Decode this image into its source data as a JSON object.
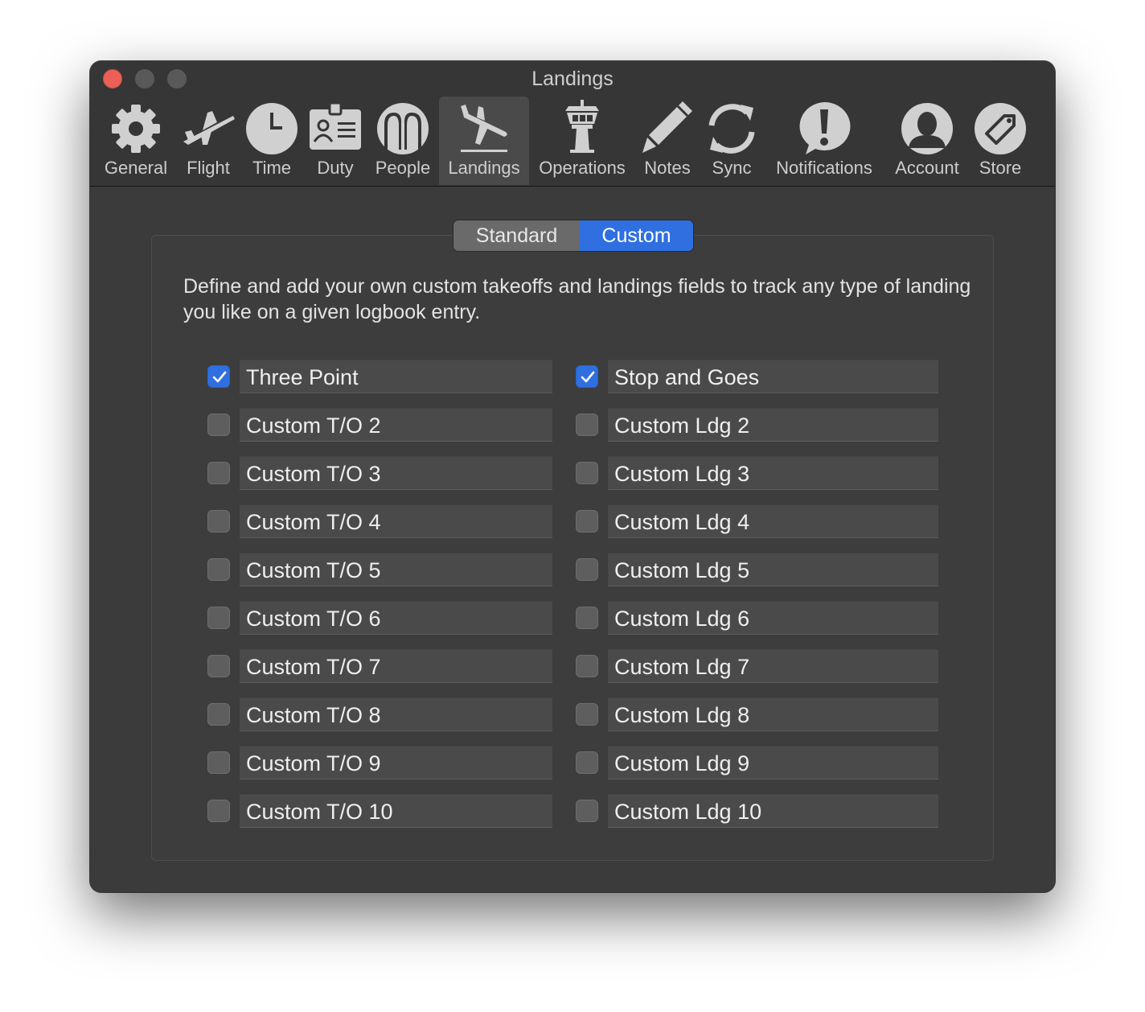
{
  "window": {
    "title": "Landings"
  },
  "toolbar": {
    "items": [
      {
        "label": "General",
        "icon": "gear-icon"
      },
      {
        "label": "Flight",
        "icon": "airplane-icon"
      },
      {
        "label": "Time",
        "icon": "clock-icon"
      },
      {
        "label": "Duty",
        "icon": "id-badge-icon"
      },
      {
        "label": "People",
        "icon": "people-icon"
      },
      {
        "label": "Landings",
        "icon": "landing-airplane-icon",
        "selected": true
      },
      {
        "label": "Operations",
        "icon": "control-tower-icon"
      },
      {
        "label": "Notes",
        "icon": "pencil-icon"
      },
      {
        "label": "Sync",
        "icon": "sync-icon"
      },
      {
        "label": "Notifications",
        "icon": "exclamation-bubble-icon"
      },
      {
        "label": "Account",
        "icon": "person-silhouette-icon"
      },
      {
        "label": "Store",
        "icon": "tag-icon"
      }
    ]
  },
  "segmented": {
    "standard_label": "Standard",
    "custom_label": "Custom",
    "selected": "Custom"
  },
  "description": "Define and add your own custom takeoffs and landings fields to track any type of landing you like on a given logbook entry.",
  "takeoffs": [
    {
      "label": "Three Point",
      "checked": true
    },
    {
      "label": "Custom T/O 2",
      "checked": false
    },
    {
      "label": "Custom T/O 3",
      "checked": false
    },
    {
      "label": "Custom T/O 4",
      "checked": false
    },
    {
      "label": "Custom T/O 5",
      "checked": false
    },
    {
      "label": "Custom T/O 6",
      "checked": false
    },
    {
      "label": "Custom T/O 7",
      "checked": false
    },
    {
      "label": "Custom T/O 8",
      "checked": false
    },
    {
      "label": "Custom T/O 9",
      "checked": false
    },
    {
      "label": "Custom T/O 10",
      "checked": false
    }
  ],
  "landings": [
    {
      "label": "Stop and Goes",
      "checked": true
    },
    {
      "label": "Custom Ldg 2",
      "checked": false
    },
    {
      "label": "Custom Ldg 3",
      "checked": false
    },
    {
      "label": "Custom Ldg 4",
      "checked": false
    },
    {
      "label": "Custom Ldg 5",
      "checked": false
    },
    {
      "label": "Custom Ldg 6",
      "checked": false
    },
    {
      "label": "Custom Ldg 7",
      "checked": false
    },
    {
      "label": "Custom Ldg 8",
      "checked": false
    },
    {
      "label": "Custom Ldg 9",
      "checked": false
    },
    {
      "label": "Custom Ldg 10",
      "checked": false
    }
  ],
  "colors": {
    "accent": "#2f6fe0",
    "close": "#ec5f57",
    "window_bg": "#3b3b3b"
  }
}
